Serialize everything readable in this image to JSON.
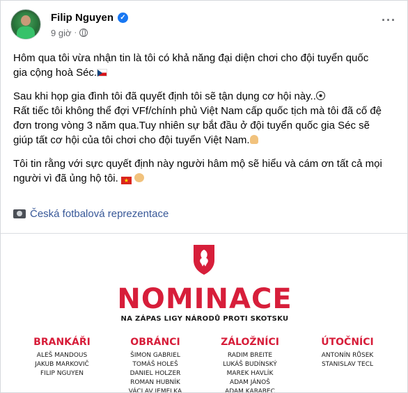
{
  "post": {
    "author": "Filip Nguyen",
    "time": "9 giờ",
    "paragraphs": [
      "Hôm qua tôi vừa nhận tin là tôi có khả năng đại diện chơi cho đội tuyển quốc gia cộng hoà Séc.",
      "Sau khi họp gia đình tôi đã quyết định tôi sẽ tận dụng cơ hội này..",
      "Rất tiếc tôi không thể đợi VFf/chính phủ Việt Nam cấp quốc tịch mà tôi đã cố đệ đơn trong vòng 3 năm qua.Tuy nhiên sự bắt đầu ở đội tuyển quốc gia Séc sẽ giúp tất cơ hội của tôi chơi cho đội tuyển Việt Nam.",
      "Tôi tin rằng với sực quyết định này người hâm mộ sẽ hiểu và cám ơn tất cả mọi người vì đã ủng hộ tôi."
    ],
    "tag": "Česká fotbalová reprezentace",
    "icons": [
      "verified-badge-icon",
      "globe-icon",
      "more-icon",
      "czech-flag",
      "soccer-ball",
      "praying-hands",
      "vietnam-flag",
      "clapping-hands",
      "camera-icon"
    ]
  },
  "graphic": {
    "title": "NOMINACE",
    "subtitle": "NA ZÁPAS LIGY NÁRODŮ PROTI SKOTSKU",
    "columns": [
      {
        "heading": "BRANKÁŘI",
        "players": [
          "ALEŠ MANDOUS",
          "JAKUB MARKOVIČ",
          "FILIP NGUYEN"
        ]
      },
      {
        "heading": "OBRÁNCI",
        "players": [
          "ŠIMON GABRIEL",
          "TOMÁŠ HOLEŠ",
          "DANIEL HOLZER",
          "ROMAN HUBNÍK",
          "VÁCLAV JEMELKA"
        ]
      },
      {
        "heading": "ZÁLOŽNÍCI",
        "players": [
          "RADIM BREITE",
          "LUKÁŠ BUDÍNSKÝ",
          "MAREK HAVLÍK",
          "ADAM JÁNOŠ",
          "ADAM KARABEC"
        ]
      },
      {
        "heading": "ÚTOČNÍCI",
        "players": [
          "ANTONÍN RŮSEK",
          "STANISLAV TECL"
        ]
      }
    ],
    "accent_color": "#d71e3a"
  }
}
